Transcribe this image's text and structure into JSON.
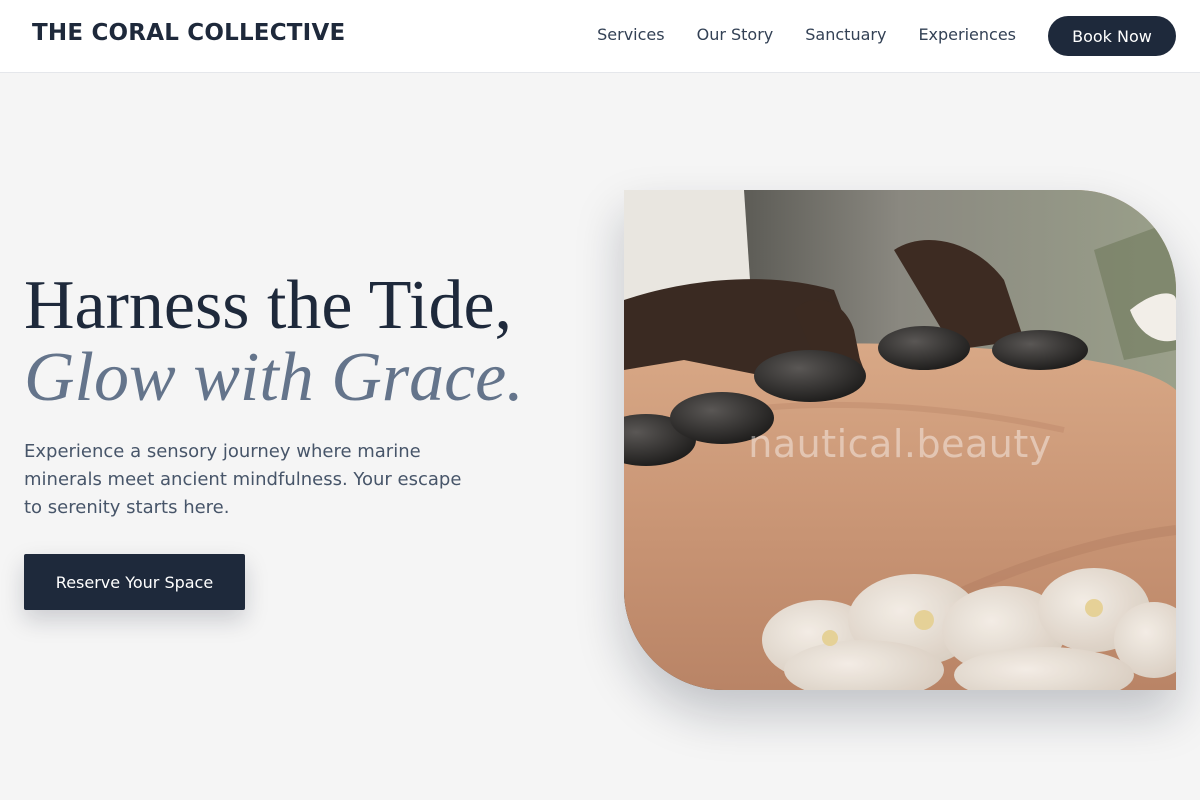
{
  "brand": {
    "name": "THE CORAL COLLECTIVE"
  },
  "nav": {
    "links": [
      "Services",
      "Our Story",
      "Sanctuary",
      "Experiences"
    ],
    "book_label": "Book Now"
  },
  "hero": {
    "title_line1": "Harness the Tide,",
    "title_line2": "Glow with Grace.",
    "lede": "Experience a sensory journey where marine minerals meet ancient mindfulness. Your escape to serenity starts here.",
    "cta_label": "Reserve Your Space",
    "image": {
      "depicts": "hot-stone-massage",
      "watermark": "nautical.beauty"
    }
  },
  "colors": {
    "primary": "#1e293b",
    "accent": "#64748b",
    "background": "#f5f5f5"
  }
}
